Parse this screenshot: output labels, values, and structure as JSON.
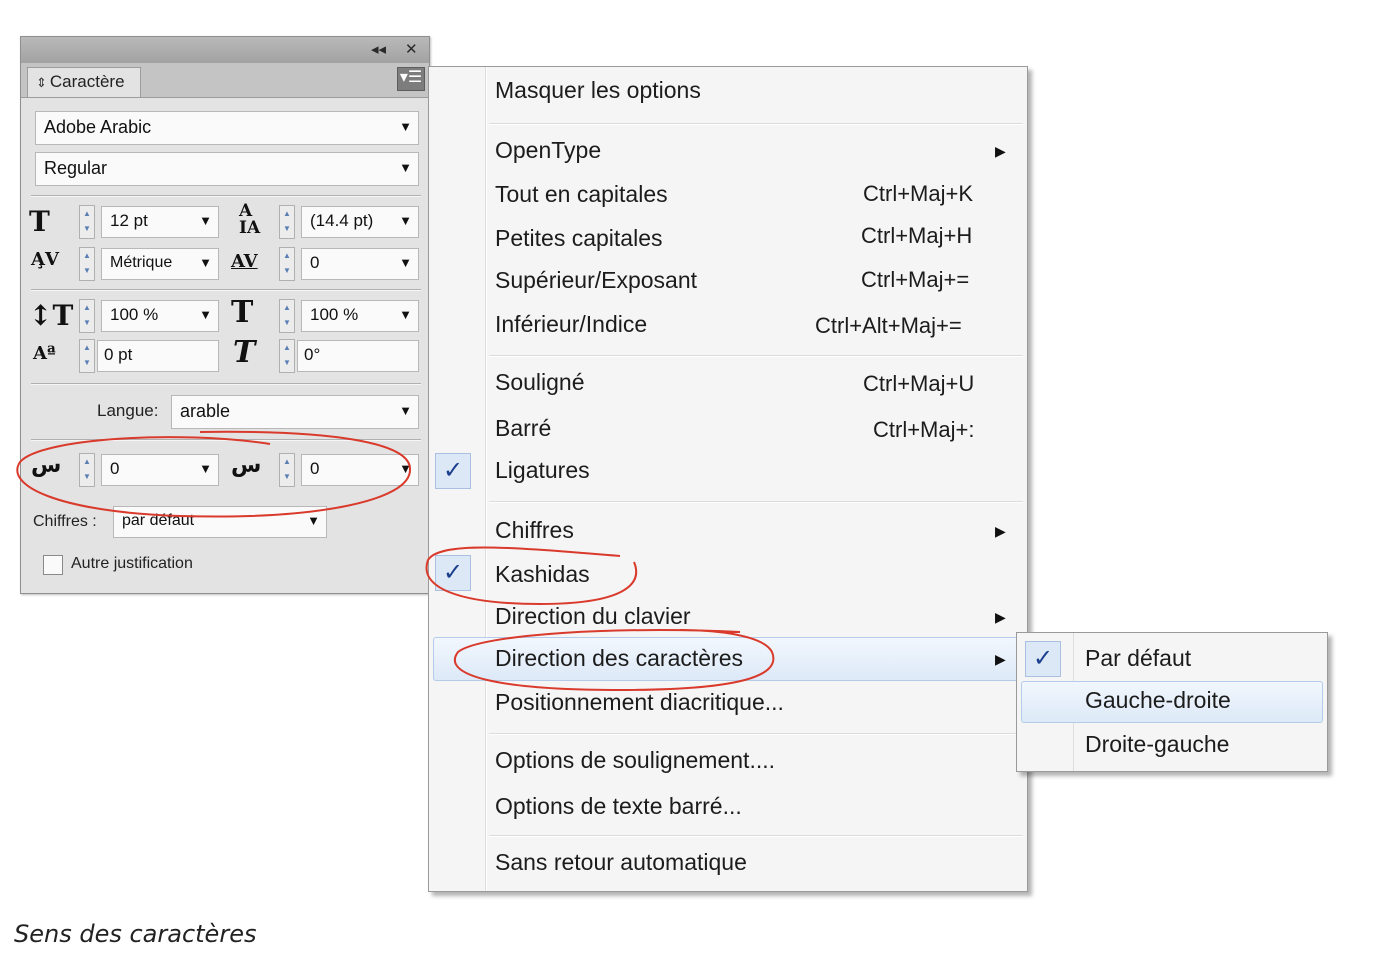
{
  "panel": {
    "title_controls": {
      "collapse": "◂◂",
      "close": "✕"
    },
    "tab_label": "Caractère",
    "font_family": "Adobe Arabic",
    "font_style": "Regular",
    "font_size": "12 pt",
    "leading": "(14.4 pt)",
    "kerning": "Métrique",
    "tracking": "0",
    "vertical_scale": "100 %",
    "horizontal_scale": "100 %",
    "baseline_shift": "0 pt",
    "skew": "0°",
    "language_label": "Langue:",
    "language_value": "arable",
    "arabic_left_value": "0",
    "arabic_right_value": "0",
    "digits_label": "Chiffres :",
    "digits_value": "par défaut",
    "alt_justification_label": "Autre justification"
  },
  "menu": {
    "items": {
      "masquer_options": "Masquer les options",
      "opentype": "OpenType",
      "tout_capitales": "Tout en capitales",
      "petites_capitales": "Petites capitales",
      "superieur": "Supérieur/Exposant",
      "inferieur": "Inférieur/Indice",
      "souligne": "Souligné",
      "barre": "Barré",
      "ligatures": "Ligatures",
      "chiffres": "Chiffres",
      "kashidas": "Kashidas",
      "direction_clavier": "Direction du clavier",
      "direction_caracteres": "Direction des caractères",
      "positionnement": "Positionnement diacritique...",
      "options_soulignement": "Options de soulignement....",
      "options_barre": "Options de texte barré...",
      "sans_retour": "Sans retour automatique"
    },
    "shortcuts": {
      "tout_capitales": "Ctrl+Maj+K",
      "petites_capitales": "Ctrl+Maj+H",
      "superieur": "Ctrl+Maj+=",
      "inferieur": "Ctrl+Alt+Maj+=",
      "souligne": "Ctrl+Maj+U",
      "barre": "Ctrl+Maj+:"
    },
    "checked": [
      "Ligatures",
      "Kashidas"
    ]
  },
  "submenu": {
    "items": [
      "Par défaut",
      "Gauche-droite",
      "Droite-gauche"
    ],
    "checked": "Par défaut",
    "highlighted": "Gauche-droite"
  },
  "caption": "Sens des caractères",
  "colors": {
    "annotation": "#d93a2b",
    "highlight": "#dde9f8",
    "check": "#1a3f8c"
  }
}
